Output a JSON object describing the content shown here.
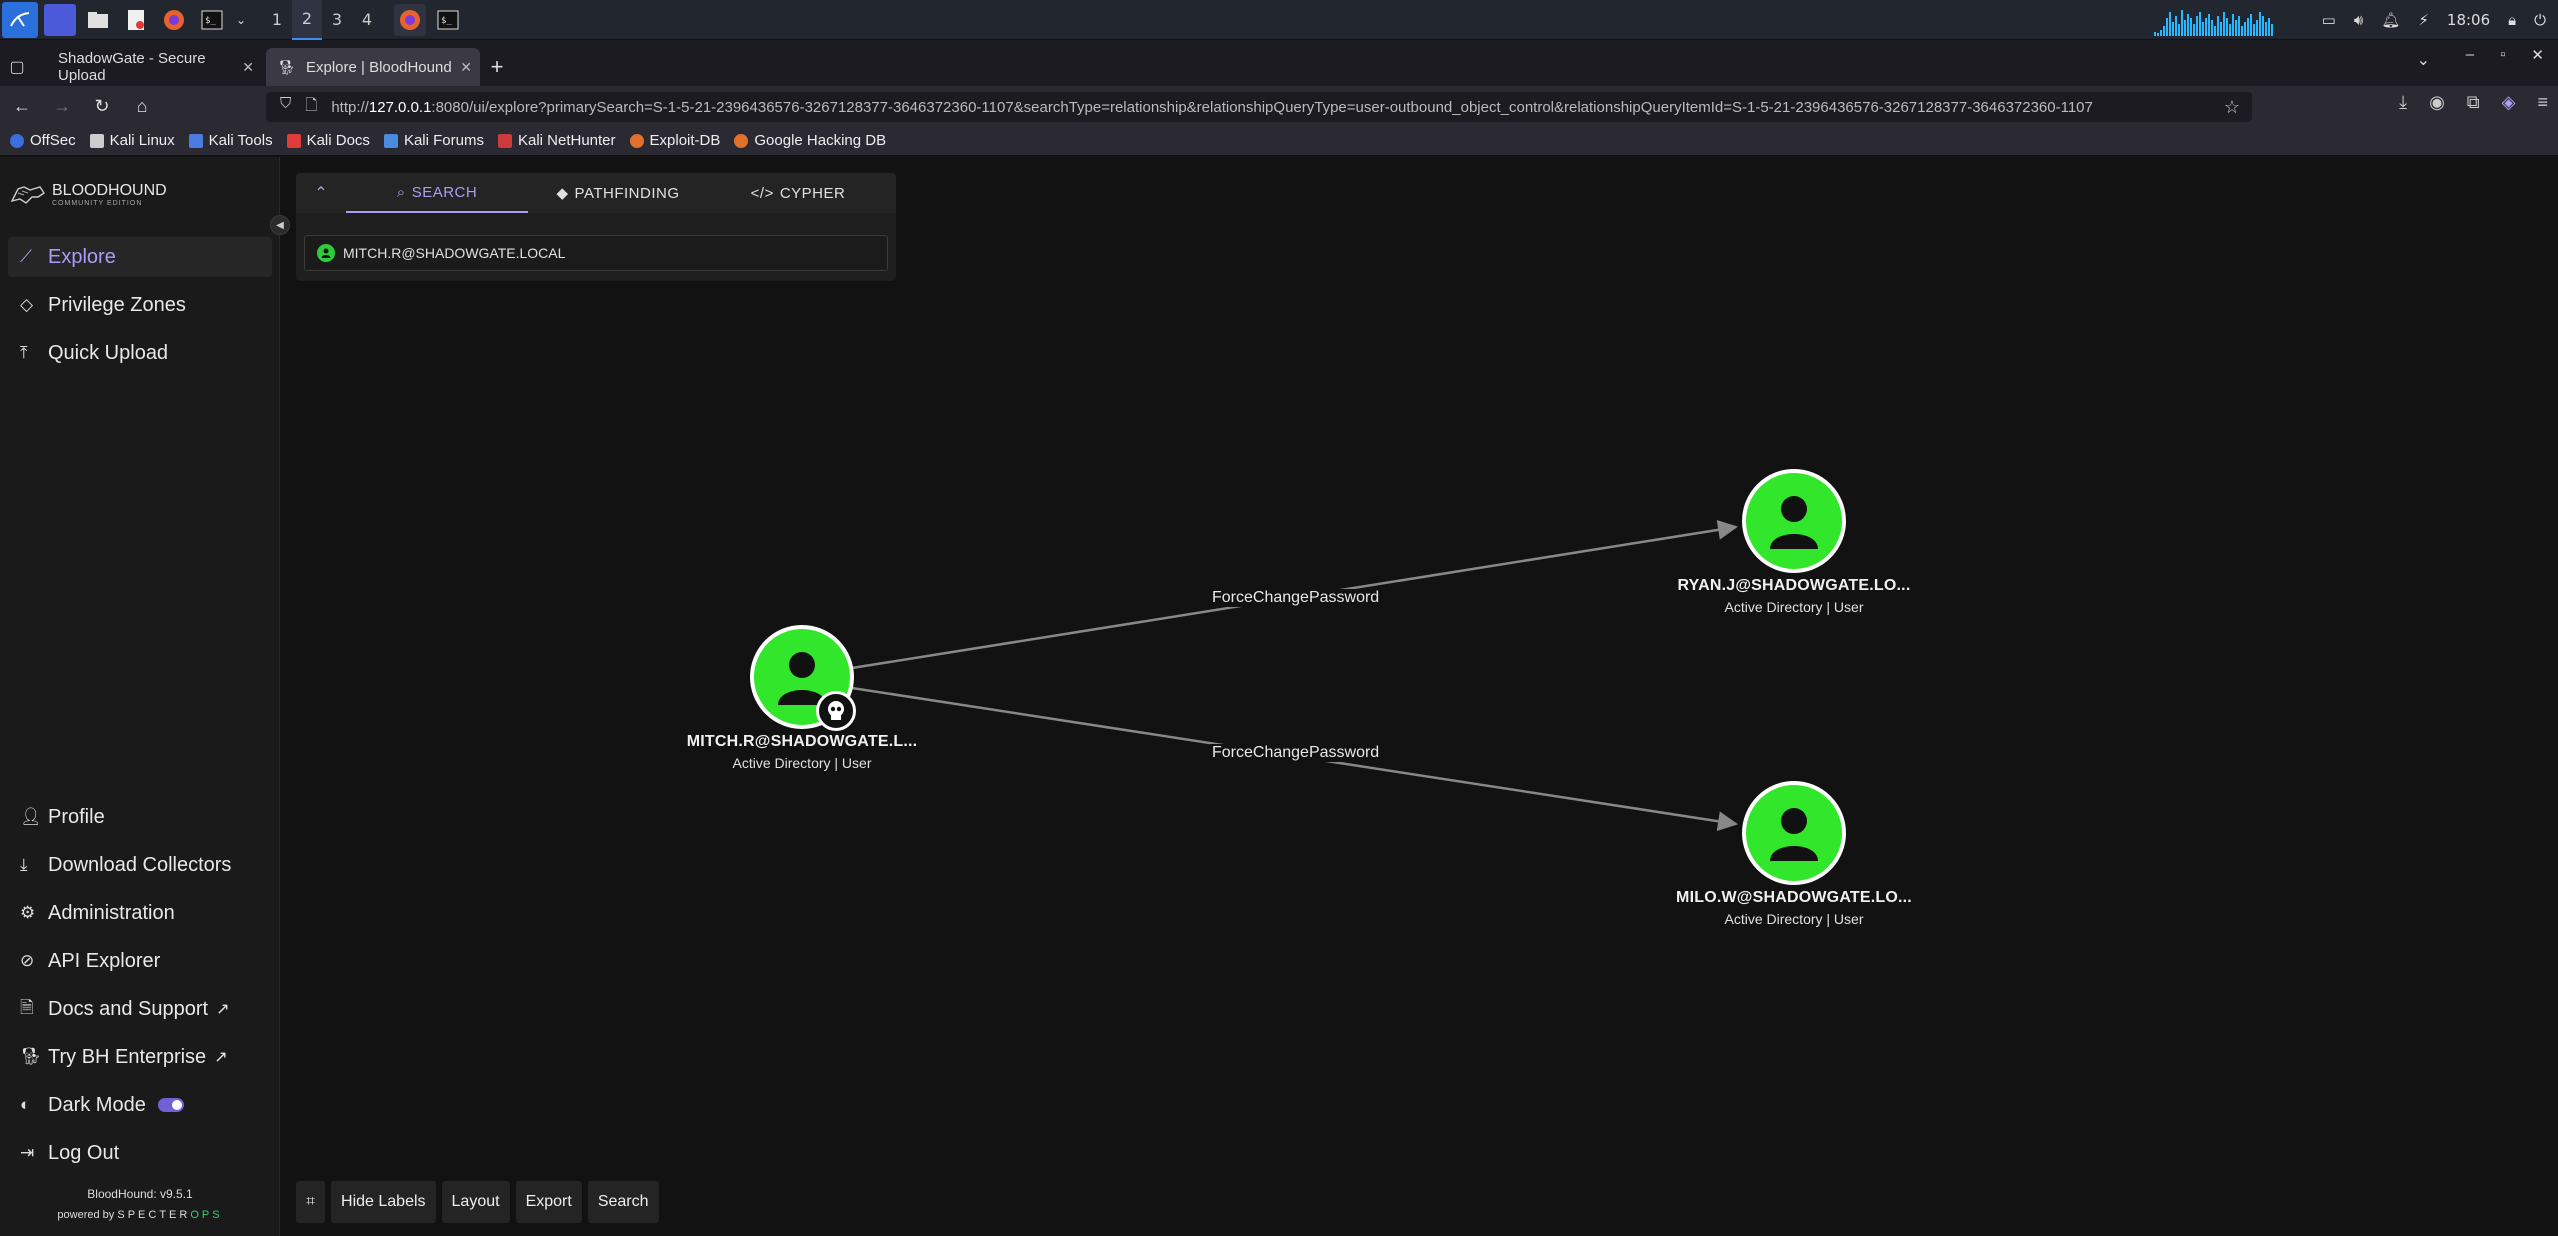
{
  "taskbar": {
    "workspaces": [
      "1",
      "2",
      "3",
      "4"
    ],
    "active_workspace": "2",
    "clock": "18:06"
  },
  "browser": {
    "tabs": [
      {
        "title": "ShadowGate - Secure Upload"
      },
      {
        "title": "Explore | BloodHound Co"
      }
    ],
    "url_prefix": "http://",
    "url_host": "127.0.0.1",
    "url_rest": ":8080/ui/explore?primarySearch=S-1-5-21-2396436576-3267128377-3646372360-1107&searchType=relationship&relationshipQueryType=user-outbound_object_control&relationshipQueryItemId=S-1-5-21-2396436576-3267128377-3646372360-1107",
    "bookmarks": [
      "OffSec",
      "Kali Linux",
      "Kali Tools",
      "Kali Docs",
      "Kali Forums",
      "Kali NetHunter",
      "Exploit-DB",
      "Google Hacking DB"
    ],
    "bookmark_colors": [
      "#3b6fe0",
      "#cccccc",
      "#4a7be0",
      "#e03b3b",
      "#4a8be0",
      "#cc3b3b",
      "#e0702b",
      "#e0702b"
    ]
  },
  "app": {
    "logo_title": "BLOODHOUND",
    "logo_sub": "COMMUNITY EDITION",
    "nav_top": [
      "Explore",
      "Privilege Zones",
      "Quick Upload"
    ],
    "nav_bottom": [
      "Profile",
      "Download Collectors",
      "Administration",
      "API Explorer",
      "Docs and Support",
      "Try BH Enterprise",
      "Dark Mode",
      "Log Out"
    ],
    "version": "BloodHound: v9.5.1",
    "powered_by": "powered by",
    "powered_brand_a": "SPECTER",
    "powered_brand_b": "OPS",
    "accent": "#a89ef5"
  },
  "search": {
    "tabs": [
      "SEARCH",
      "PATHFINDING",
      "CYPHER"
    ],
    "active_tab": "SEARCH",
    "value": "MITCH.R@SHADOWGATE.LOCAL"
  },
  "graph": {
    "nodes": [
      {
        "label": "MITCH.R@SHADOWGATE.L...",
        "sub": "Active Directory | User",
        "owned": true
      },
      {
        "label": "RYAN.J@SHADOWGATE.LO...",
        "sub": "Active Directory | User"
      },
      {
        "label": "MILO.W@SHADOWGATE.LO...",
        "sub": "Active Directory | User"
      }
    ],
    "edges": [
      {
        "label": "ForceChangePassword",
        "from": "MITCH.R@SHADOWGATE.L...",
        "to": "RYAN.J@SHADOWGATE.LO..."
      },
      {
        "label": "ForceChangePassword",
        "from": "MITCH.R@SHADOWGATE.L...",
        "to": "MILO.W@SHADOWGATE.LO..."
      }
    ],
    "node_color": "#32e62b"
  },
  "toolbar": {
    "buttons": [
      "Hide Labels",
      "Layout",
      "Export",
      "Search"
    ]
  }
}
